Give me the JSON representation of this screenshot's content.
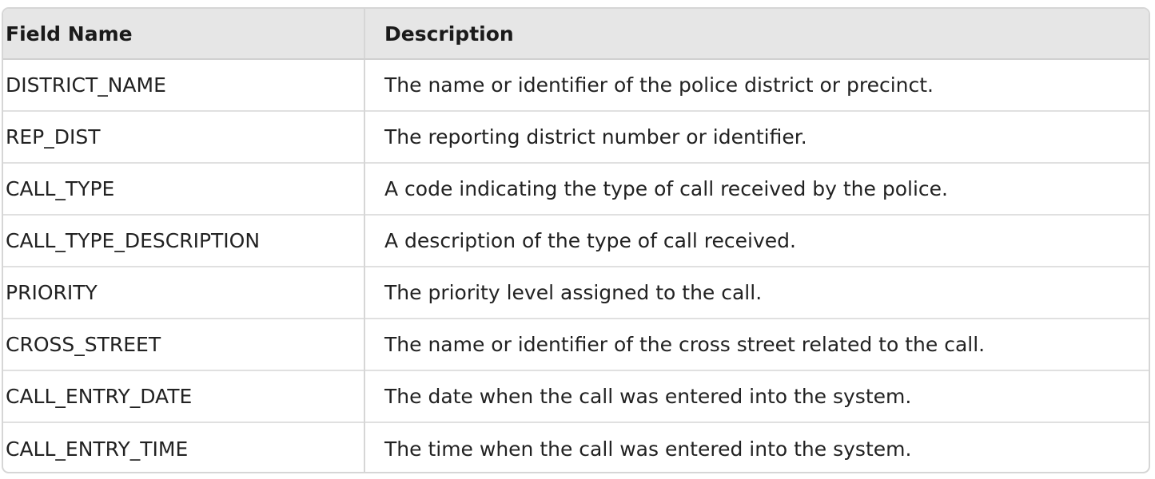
{
  "table": {
    "headers": [
      "Field Name",
      "Description"
    ],
    "rows": [
      [
        "DISTRICT_NAME",
        "The name or identifier of the police district or precinct."
      ],
      [
        "REP_DIST",
        "The reporting district number or identifier."
      ],
      [
        "CALL_TYPE",
        "A code indicating the type of call received by the police."
      ],
      [
        "CALL_TYPE_DESCRIPTION",
        "A description of the type of call received."
      ],
      [
        "PRIORITY",
        "The priority level assigned to the call."
      ],
      [
        "CROSS_STREET",
        "The name or identifier of the cross street related to the call."
      ],
      [
        "CALL_ENTRY_DATE",
        "The date when the call was entered into the system."
      ],
      [
        "CALL_ENTRY_TIME",
        "The time when the call was entered into the system."
      ]
    ]
  }
}
